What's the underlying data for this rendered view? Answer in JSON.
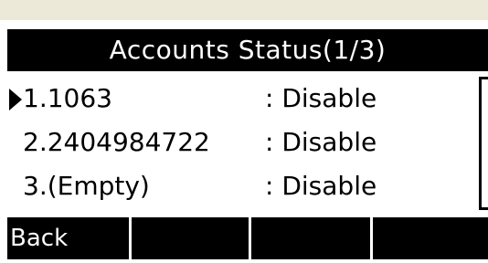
{
  "title": "Accounts Status(1/3)",
  "accounts": [
    {
      "name": "1.1063",
      "status": ": Disable",
      "selected": true
    },
    {
      "name": "2.2404984722",
      "status": ": Disable",
      "selected": false
    },
    {
      "name": "3.(Empty)",
      "status": ": Disable",
      "selected": false
    }
  ],
  "softkeys": [
    "Back",
    "",
    "",
    ""
  ],
  "selection_arrow_icon": "right-triangle-icon"
}
